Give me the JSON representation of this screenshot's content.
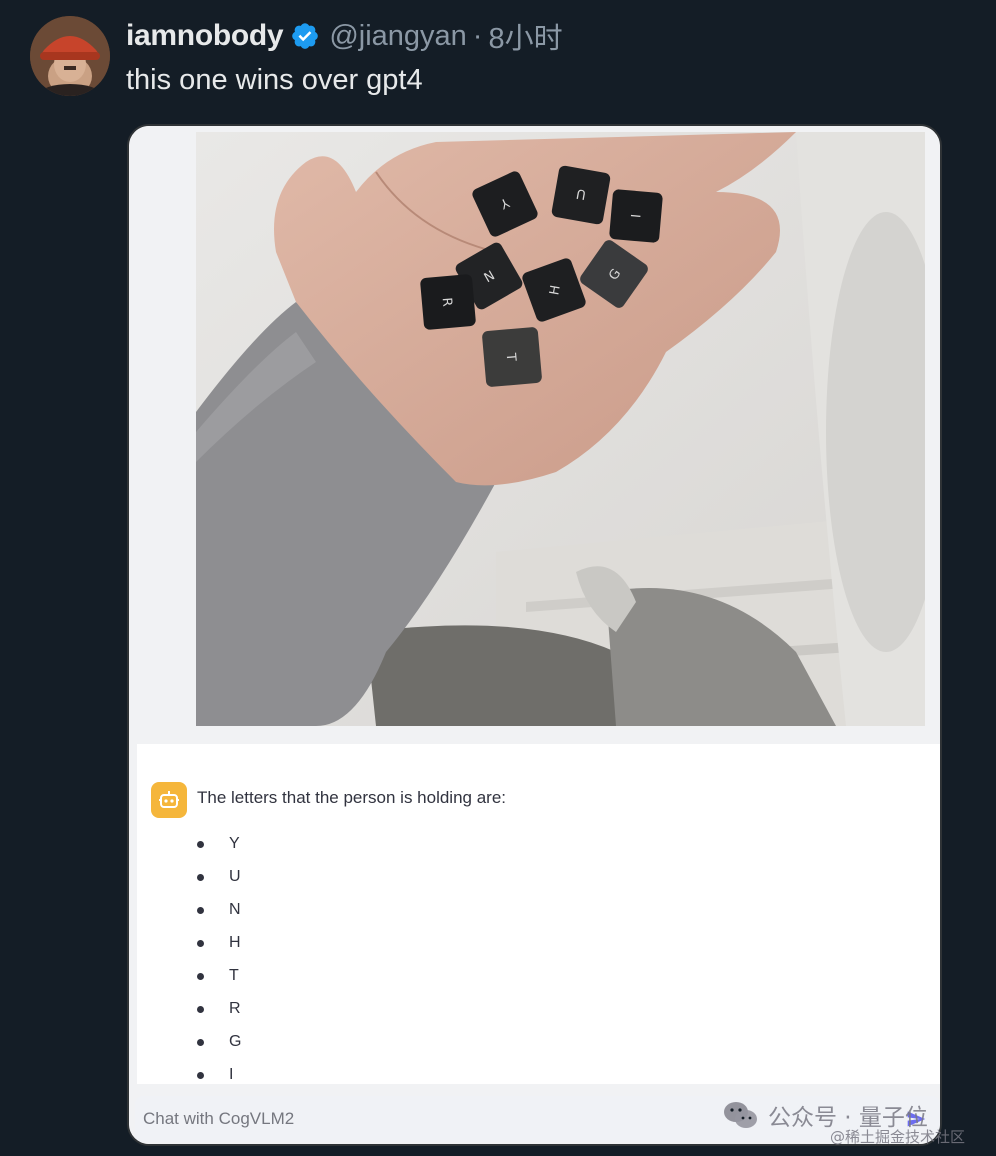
{
  "tweet": {
    "display_name": "iamnobody",
    "handle": "@jiangyan",
    "separator": "·",
    "time": "8小时",
    "text": "this one wins over gpt4",
    "avatar_icon": "user-avatar-red-hat",
    "verified_icon": "verified-badge-icon"
  },
  "media": {
    "photo_icon": "hand-holding-keycaps-photo",
    "keycaps": [
      "Y",
      "U",
      "I",
      "N",
      "H",
      "G",
      "R",
      "T"
    ],
    "response": {
      "bot_icon": "robot-icon",
      "intro": "The letters that the person is holding are:",
      "letters": [
        "Y",
        "U",
        "N",
        "H",
        "T",
        "R",
        "G",
        "I"
      ]
    },
    "input": {
      "placeholder": "Chat with CogVLM2",
      "send_icon": "send-icon"
    }
  },
  "watermark": {
    "line1": "公众号 · 量子位",
    "line2": "@稀土掘金技术社区",
    "wechat_icon": "wechat-icon"
  },
  "colors": {
    "background": "#141d26",
    "verified": "#1d9bf0",
    "bot_accent": "#f5b63b"
  }
}
